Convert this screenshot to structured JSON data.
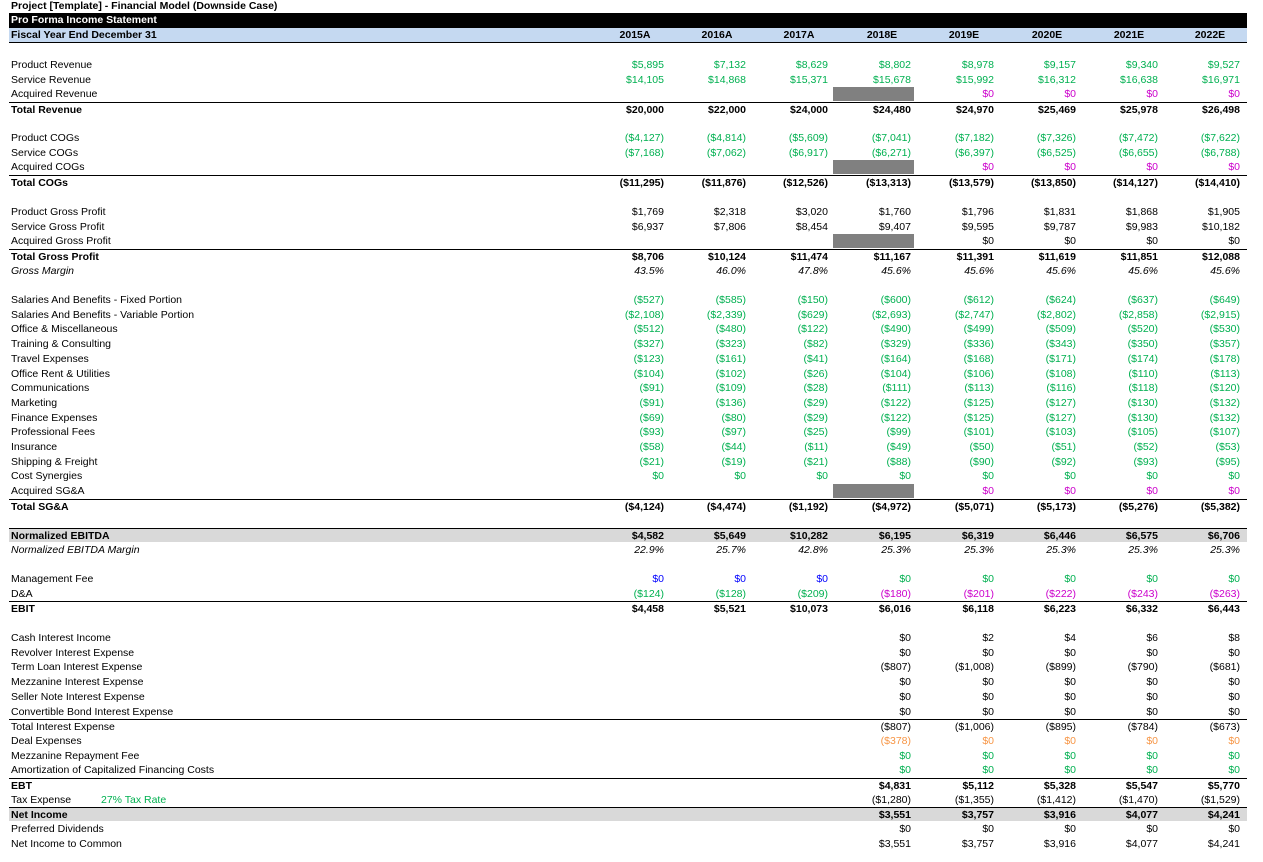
{
  "title": "Project [Template] - Financial Model (Downside Case)",
  "statement_title": "Pro Forma Income Statement",
  "fiscal_label": "Fiscal Year End December 31",
  "years": [
    "2015A",
    "2016A",
    "2017A",
    "2018E",
    "2019E",
    "2020E",
    "2021E",
    "2022E"
  ],
  "tax_rate_label": "27% Tax Rate",
  "sections": [
    {
      "rows": [
        {
          "label": "Product Revenue",
          "color": "green",
          "values": [
            "$5,895",
            "$7,132",
            "$8,629",
            "$8,802",
            "$8,978",
            "$9,157",
            "$9,340",
            "$9,527"
          ]
        },
        {
          "label": "Service Revenue",
          "color": "green",
          "values": [
            "$14,105",
            "$14,868",
            "$15,371",
            "$15,678",
            "$15,992",
            "$16,312",
            "$16,638",
            "$16,971"
          ]
        },
        {
          "label": "Acquired Revenue",
          "color": "mag",
          "gray2018": true,
          "values": [
            "",
            "",
            "",
            "",
            "$0",
            "$0",
            "$0",
            "$0"
          ]
        },
        {
          "label": "Total Revenue",
          "style": "total",
          "values": [
            "$20,000",
            "$22,000",
            "$24,000",
            "$24,480",
            "$24,970",
            "$25,469",
            "$25,978",
            "$26,498"
          ]
        }
      ]
    },
    {
      "rows": [
        {
          "label": "Product COGs",
          "color": "green",
          "values": [
            "($4,127)",
            "($4,814)",
            "($5,609)",
            "($7,041)",
            "($7,182)",
            "($7,326)",
            "($7,472)",
            "($7,622)"
          ]
        },
        {
          "label": "Service COGs",
          "color": "green",
          "values": [
            "($7,168)",
            "($7,062)",
            "($6,917)",
            "($6,271)",
            "($6,397)",
            "($6,525)",
            "($6,655)",
            "($6,788)"
          ]
        },
        {
          "label": "Acquired COGs",
          "color": "mag",
          "gray2018": true,
          "values": [
            "",
            "",
            "",
            "",
            "$0",
            "$0",
            "$0",
            "$0"
          ]
        },
        {
          "label": "Total COGs",
          "style": "total",
          "values": [
            "($11,295)",
            "($11,876)",
            "($12,526)",
            "($13,313)",
            "($13,579)",
            "($13,850)",
            "($14,127)",
            "($14,410)"
          ]
        }
      ]
    },
    {
      "rows": [
        {
          "label": "Product Gross Profit",
          "values": [
            "$1,769",
            "$2,318",
            "$3,020",
            "$1,760",
            "$1,796",
            "$1,831",
            "$1,868",
            "$1,905"
          ]
        },
        {
          "label": "Service Gross Profit",
          "values": [
            "$6,937",
            "$7,806",
            "$8,454",
            "$9,407",
            "$9,595",
            "$9,787",
            "$9,983",
            "$10,182"
          ]
        },
        {
          "label": "Acquired Gross Profit",
          "gray2018": true,
          "values": [
            "",
            "",
            "",
            "",
            "$0",
            "$0",
            "$0",
            "$0"
          ]
        },
        {
          "label": "Total Gross Profit",
          "style": "total",
          "values": [
            "$8,706",
            "$10,124",
            "$11,474",
            "$11,167",
            "$11,391",
            "$11,619",
            "$11,851",
            "$12,088"
          ]
        },
        {
          "label": "Gross Margin",
          "style": "ital",
          "values": [
            "43.5%",
            "46.0%",
            "47.8%",
            "45.6%",
            "45.6%",
            "45.6%",
            "45.6%",
            "45.6%"
          ]
        }
      ]
    },
    {
      "rows": [
        {
          "label": "Salaries And Benefits - Fixed Portion",
          "color": "green",
          "values": [
            "($527)",
            "($585)",
            "($150)",
            "($600)",
            "($612)",
            "($624)",
            "($637)",
            "($649)"
          ]
        },
        {
          "label": "Salaries And Benefits - Variable Portion",
          "color": "green",
          "values": [
            "($2,108)",
            "($2,339)",
            "($629)",
            "($2,693)",
            "($2,747)",
            "($2,802)",
            "($2,858)",
            "($2,915)"
          ]
        },
        {
          "label": "Office & Miscellaneous",
          "color": "green",
          "values": [
            "($512)",
            "($480)",
            "($122)",
            "($490)",
            "($499)",
            "($509)",
            "($520)",
            "($530)"
          ]
        },
        {
          "label": "Training & Consulting",
          "color": "green",
          "values": [
            "($327)",
            "($323)",
            "($82)",
            "($329)",
            "($336)",
            "($343)",
            "($350)",
            "($357)"
          ]
        },
        {
          "label": "Travel Expenses",
          "color": "green",
          "values": [
            "($123)",
            "($161)",
            "($41)",
            "($164)",
            "($168)",
            "($171)",
            "($174)",
            "($178)"
          ]
        },
        {
          "label": "Office Rent & Utilities",
          "color": "green",
          "values": [
            "($104)",
            "($102)",
            "($26)",
            "($104)",
            "($106)",
            "($108)",
            "($110)",
            "($113)"
          ]
        },
        {
          "label": "Communications",
          "color": "green",
          "values": [
            "($91)",
            "($109)",
            "($28)",
            "($111)",
            "($113)",
            "($116)",
            "($118)",
            "($120)"
          ]
        },
        {
          "label": "Marketing",
          "color": "green",
          "values": [
            "($91)",
            "($136)",
            "($29)",
            "($122)",
            "($125)",
            "($127)",
            "($130)",
            "($132)"
          ]
        },
        {
          "label": "Finance Expenses",
          "color": "green",
          "values": [
            "($69)",
            "($80)",
            "($29)",
            "($122)",
            "($125)",
            "($127)",
            "($130)",
            "($132)"
          ]
        },
        {
          "label": "Professional Fees",
          "color": "green",
          "values": [
            "($93)",
            "($97)",
            "($25)",
            "($99)",
            "($101)",
            "($103)",
            "($105)",
            "($107)"
          ]
        },
        {
          "label": "Insurance",
          "color": "green",
          "values": [
            "($58)",
            "($44)",
            "($11)",
            "($49)",
            "($50)",
            "($51)",
            "($52)",
            "($53)"
          ]
        },
        {
          "label": "Shipping & Freight",
          "color": "green",
          "values": [
            "($21)",
            "($19)",
            "($21)",
            "($88)",
            "($90)",
            "($92)",
            "($93)",
            "($95)"
          ]
        },
        {
          "label": "Cost Synergies",
          "color": "green",
          "values": [
            "$0",
            "$0",
            "$0",
            "$0",
            "$0",
            "$0",
            "$0",
            "$0"
          ]
        },
        {
          "label": "Acquired SG&A",
          "color": "mag",
          "gray2018": true,
          "values": [
            "",
            "",
            "",
            "",
            "$0",
            "$0",
            "$0",
            "$0"
          ]
        },
        {
          "label": "Total SG&A",
          "style": "total",
          "values": [
            "($4,124)",
            "($4,474)",
            "($1,192)",
            "($4,972)",
            "($5,071)",
            "($5,173)",
            "($5,276)",
            "($5,382)"
          ]
        }
      ]
    },
    {
      "rows": [
        {
          "label": "Normalized EBITDA",
          "style": "shade",
          "values": [
            "$4,582",
            "$5,649",
            "$10,282",
            "$6,195",
            "$6,319",
            "$6,446",
            "$6,575",
            "$6,706"
          ]
        },
        {
          "label": "Normalized EBITDA Margin",
          "style": "ital",
          "values": [
            "22.9%",
            "25.7%",
            "42.8%",
            "25.3%",
            "25.3%",
            "25.3%",
            "25.3%",
            "25.3%"
          ]
        }
      ]
    },
    {
      "rows": [
        {
          "label": "Management Fee",
          "color": "blue",
          "colorEst": "green",
          "values": [
            "$0",
            "$0",
            "$0",
            "$0",
            "$0",
            "$0",
            "$0",
            "$0"
          ]
        },
        {
          "label": "D&A",
          "color": "green",
          "colorEst": "mag",
          "values": [
            "($124)",
            "($128)",
            "($209)",
            "($180)",
            "($201)",
            "($222)",
            "($243)",
            "($263)"
          ]
        },
        {
          "label": "EBIT",
          "style": "total",
          "values": [
            "$4,458",
            "$5,521",
            "$10,073",
            "$6,016",
            "$6,118",
            "$6,223",
            "$6,332",
            "$6,443"
          ]
        }
      ]
    },
    {
      "rows": [
        {
          "label": "Cash Interest Income",
          "values": [
            "",
            "",
            "",
            "$0",
            "$2",
            "$4",
            "$6",
            "$8"
          ]
        },
        {
          "label": "Revolver Interest Expense",
          "values": [
            "",
            "",
            "",
            "$0",
            "$0",
            "$0",
            "$0",
            "$0"
          ]
        },
        {
          "label": "Term Loan Interest Expense",
          "values": [
            "",
            "",
            "",
            "($807)",
            "($1,008)",
            "($899)",
            "($790)",
            "($681)"
          ]
        },
        {
          "label": "Mezzanine Interest Expense",
          "values": [
            "",
            "",
            "",
            "$0",
            "$0",
            "$0",
            "$0",
            "$0"
          ]
        },
        {
          "label": "Seller Note Interest Expense",
          "values": [
            "",
            "",
            "",
            "$0",
            "$0",
            "$0",
            "$0",
            "$0"
          ]
        },
        {
          "label": "Convertible Bond Interest Expense",
          "values": [
            "",
            "",
            "",
            "$0",
            "$0",
            "$0",
            "$0",
            "$0"
          ]
        },
        {
          "label": "Total Interest Expense",
          "style": "totalplain",
          "values": [
            "",
            "",
            "",
            "($807)",
            "($1,006)",
            "($895)",
            "($784)",
            "($673)"
          ]
        },
        {
          "label": "Deal Expenses",
          "color": "orange",
          "values": [
            "",
            "",
            "",
            "($378)",
            "$0",
            "$0",
            "$0",
            "$0"
          ]
        },
        {
          "label": "Mezzanine Repayment Fee",
          "color": "green",
          "values": [
            "",
            "",
            "",
            "$0",
            "$0",
            "$0",
            "$0",
            "$0"
          ]
        },
        {
          "label": "Amortization of Capitalized Financing Costs",
          "color": "green",
          "values": [
            "",
            "",
            "",
            "$0",
            "$0",
            "$0",
            "$0",
            "$0"
          ]
        },
        {
          "label": "EBT",
          "style": "total",
          "values": [
            "",
            "",
            "",
            "$4,831",
            "$5,112",
            "$5,328",
            "$5,547",
            "$5,770"
          ]
        },
        {
          "label": "Tax Expense",
          "taxrate": true,
          "values": [
            "",
            "",
            "",
            "($1,280)",
            "($1,355)",
            "($1,412)",
            "($1,470)",
            "($1,529)"
          ]
        },
        {
          "label": "Net Income",
          "style": "shade",
          "values": [
            "",
            "",
            "",
            "$3,551",
            "$3,757",
            "$3,916",
            "$4,077",
            "$4,241"
          ]
        },
        {
          "label": "Preferred Dividends",
          "values": [
            "",
            "",
            "",
            "$0",
            "$0",
            "$0",
            "$0",
            "$0"
          ]
        },
        {
          "label": "Net Income to Common",
          "values": [
            "",
            "",
            "",
            "$3,551",
            "$3,757",
            "$3,916",
            "$4,077",
            "$4,241"
          ]
        }
      ]
    }
  ]
}
